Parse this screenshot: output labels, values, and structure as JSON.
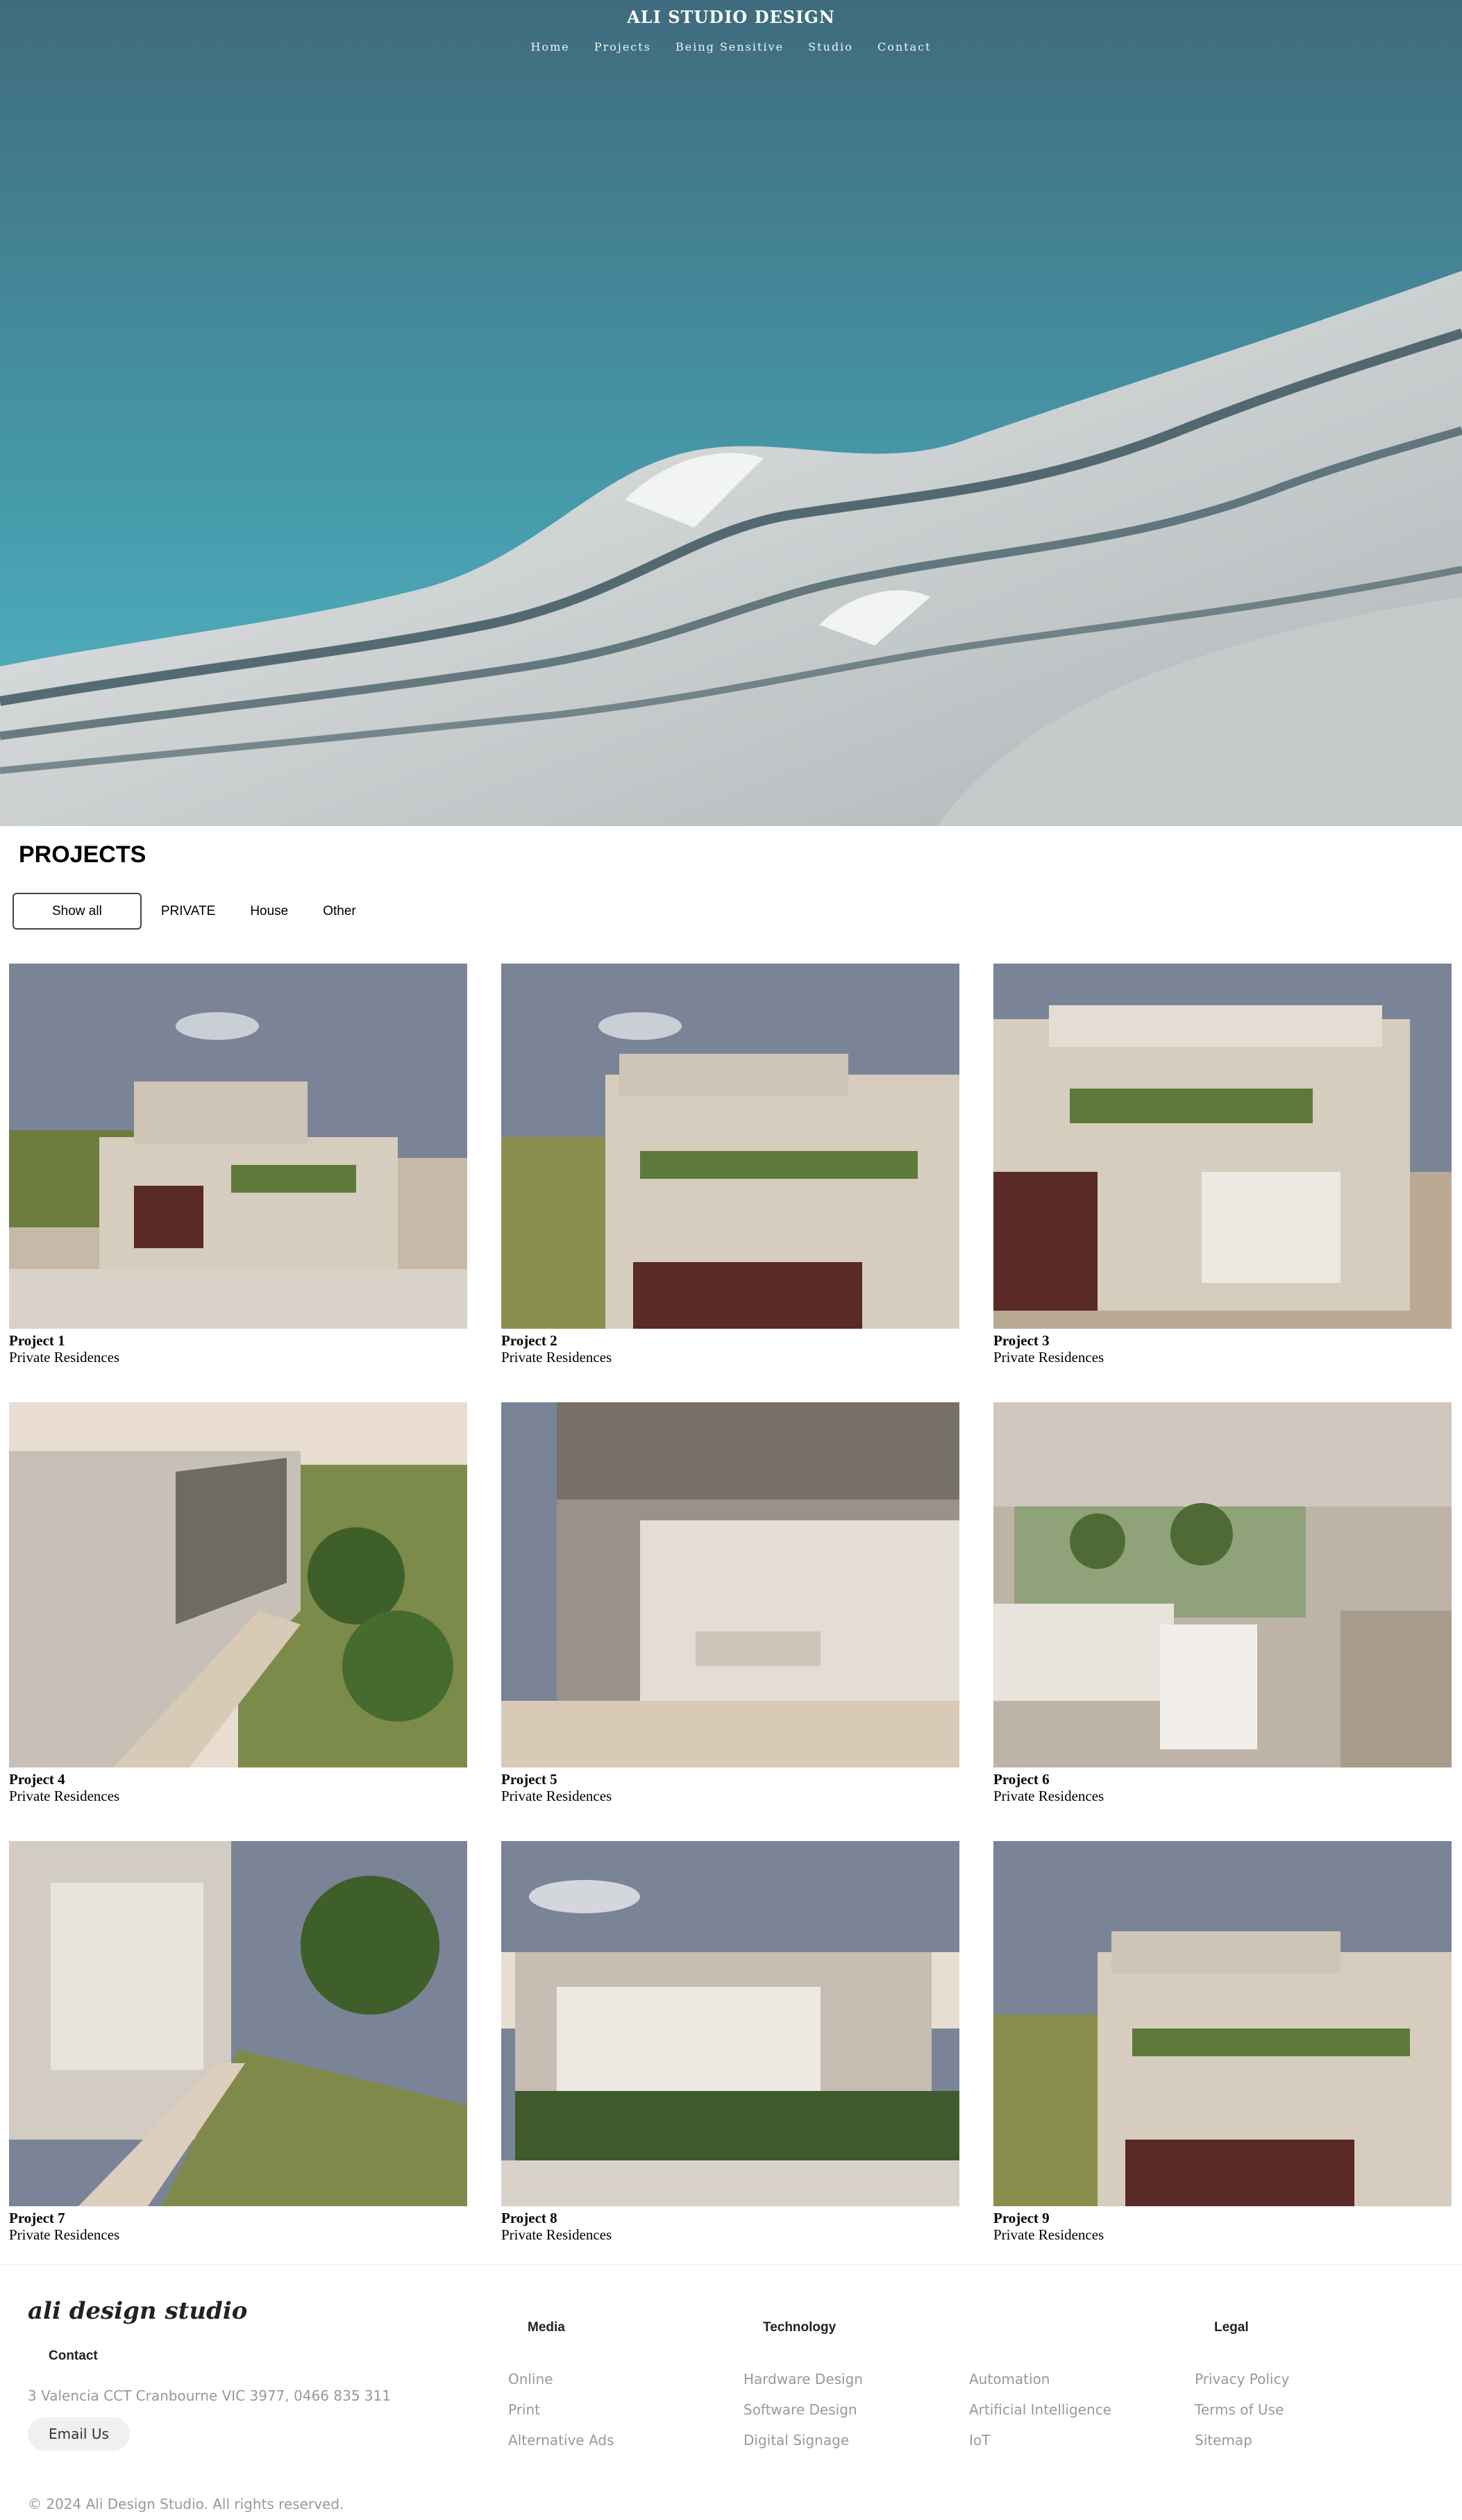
{
  "header": {
    "logo": "ALI STUDIO DESIGN",
    "nav": [
      "Home",
      "Projects",
      "Being Sensitive",
      "Studio",
      "Contact"
    ]
  },
  "projects": {
    "title": "PROJECTS",
    "filters": [
      "Show all",
      "PRIVATE",
      "House",
      "Other"
    ],
    "items": [
      {
        "name": "Project 1",
        "category": "Private Residences"
      },
      {
        "name": "Project 2",
        "category": "Private Residences"
      },
      {
        "name": "Project 3",
        "category": "Private Residences"
      },
      {
        "name": "Project 4",
        "category": "Private Residences"
      },
      {
        "name": "Project 5",
        "category": "Private Residences"
      },
      {
        "name": "Project 6",
        "category": "Private Residences"
      },
      {
        "name": "Project 7",
        "category": "Private Residences"
      },
      {
        "name": "Project 8",
        "category": "Private Residences"
      },
      {
        "name": "Project 9",
        "category": "Private Residences"
      }
    ]
  },
  "footer": {
    "brand": "ali design studio",
    "contact_heading": "Contact",
    "address": "3 Valencia CCT Cranbourne VIC 3977, 0466 835 311",
    "email_label": "Email Us",
    "media_heading": "Media",
    "media_links": [
      "Online",
      "Print",
      "Alternative Ads"
    ],
    "technology_heading": "Technology",
    "technology_links_a": [
      "Hardware Design",
      "Software Design",
      "Digital Signage"
    ],
    "technology_links_b": [
      "Automation",
      "Artificial Intelligence",
      "IoT"
    ],
    "legal_heading": "Legal",
    "legal_links": [
      "Privacy Policy",
      "Terms of Use",
      "Sitemap"
    ],
    "copyright": "© 2024 Ali Design Studio. All rights reserved."
  },
  "colors": {
    "sky_top": "#3f6b7d",
    "sky_bottom": "#4fb3c2",
    "building": "#d9dcdc",
    "text": "#000000",
    "muted": "#999999"
  }
}
